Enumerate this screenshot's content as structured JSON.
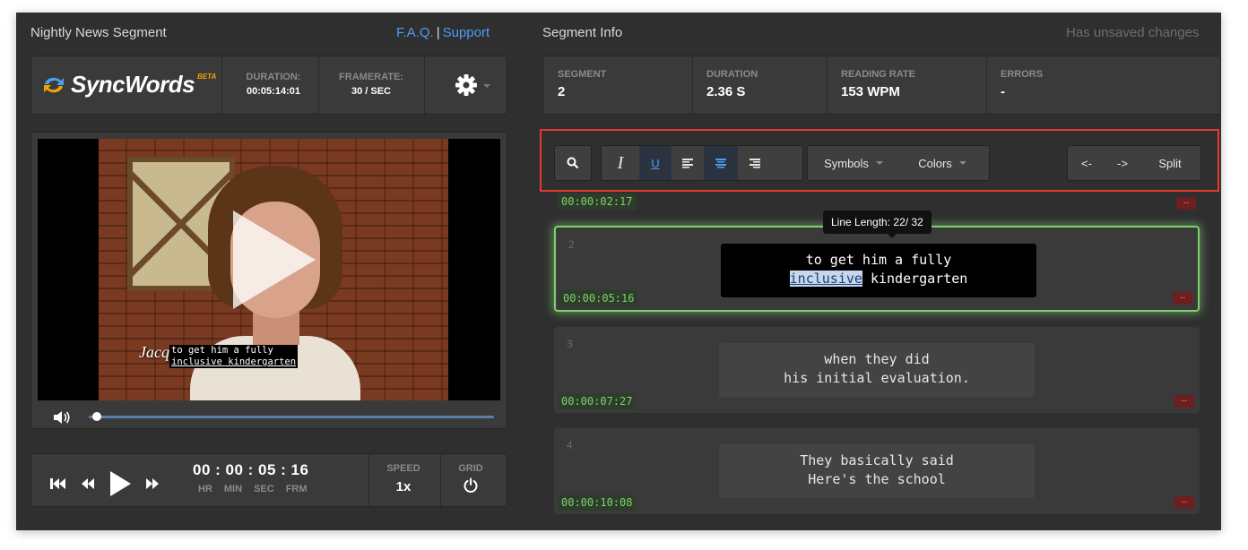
{
  "header": {
    "title": "Nightly News Segment",
    "faq": "F.A.Q.",
    "separator": "|",
    "support": "Support",
    "segment_info": "Segment Info",
    "unsaved": "Has unsaved changes"
  },
  "infobar": {
    "logo": "SyncWords",
    "beta": "BETA",
    "duration_label": "DURATION:",
    "duration_value": "00:05:14:01",
    "framerate_label": "FRAMERATE:",
    "framerate_value": "30 / SEC"
  },
  "video": {
    "caption_name": "Jacqu",
    "caption_line1": "to get him a fully",
    "caption_line2": "inclusive kindergarten",
    "progress": 0.02
  },
  "transport": {
    "timecode": "00 : 00 : 05 : 16",
    "hr": "HR",
    "min": "MIN",
    "sec": "SEC",
    "frm": "FRM",
    "speed_label": "SPEED",
    "speed_value": "1x",
    "grid_label": "GRID"
  },
  "stats": {
    "segment_label": "SEGMENT",
    "segment_value": "2",
    "duration_label": "DURATION",
    "duration_value": "2.36 S",
    "reading_label": "READING RATE",
    "reading_value": "153 WPM",
    "errors_label": "ERRORS",
    "errors_value": "-"
  },
  "toolbar": {
    "italic": "I",
    "underline": "U",
    "symbols": "Symbols",
    "colors": "Colors",
    "prev": "<-",
    "next": "->",
    "split": "Split"
  },
  "tooltip": "Line Length: 22/ 32",
  "rows": [
    {
      "timestamp": "00:00:02:17",
      "err": "--"
    },
    {
      "num": "2",
      "line1": "to get him a fully",
      "highlight": "inclusive",
      "line2_rest": " kindergarten",
      "timestamp": "00:00:05:16",
      "err": "--"
    },
    {
      "num": "3",
      "line1": "when they did",
      "line2": "his initial evaluation.",
      "timestamp": "00:00:07:27",
      "err": "--"
    },
    {
      "num": "4",
      "line1": "They basically said",
      "line2": "Here's the school",
      "timestamp": "00:00:10:08",
      "err": "--"
    }
  ]
}
